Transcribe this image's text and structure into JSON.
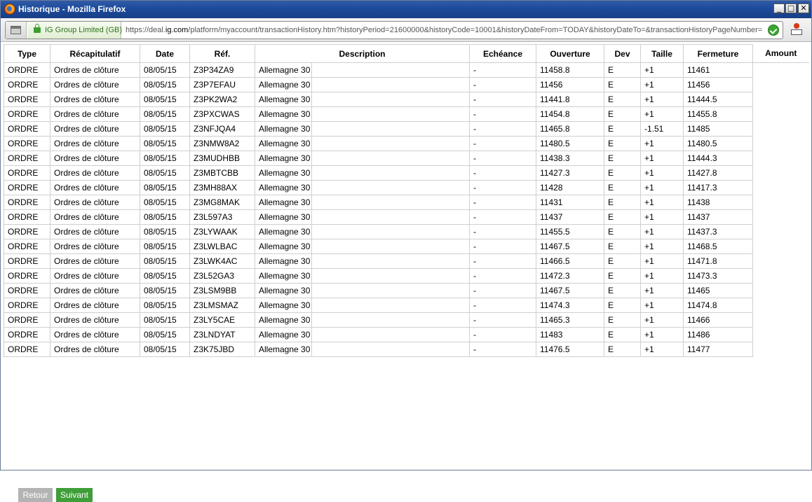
{
  "window": {
    "title": "Historique - Mozilla Firefox",
    "controls": {
      "minimize": "_",
      "maximize": "□",
      "close": "✕"
    }
  },
  "navbar": {
    "identity": "IG Group Limited (GB)",
    "url_prefix": "https://deal.",
    "url_domain": "ig.com",
    "url_rest": "/platform/myaccount/transactionHistory.htm?historyPeriod=21600000&historyCode=10001&historyDateFrom=TODAY&historyDateTo=&transactionHistoryPageNumber="
  },
  "table": {
    "headers": {
      "type": "Type",
      "summary": "Récapitulatif",
      "date": "Date",
      "ref": "Réf.",
      "description": "Description",
      "expiry": "Echéance",
      "open": "Ouverture",
      "currency": "Dev",
      "size": "Taille",
      "close": "Fermeture",
      "amount": "Amount"
    },
    "rows": [
      {
        "type": "ORDRE",
        "summary": "Ordres de clôture",
        "date": "08/05/15",
        "ref": "Z3P34ZA9",
        "description": "Allemagne 30",
        "expiry": "-",
        "open": "11458.8",
        "currency": "E",
        "size": "+1",
        "close": "11461"
      },
      {
        "type": "ORDRE",
        "summary": "Ordres de clôture",
        "date": "08/05/15",
        "ref": "Z3P7EFAU",
        "description": "Allemagne 30",
        "expiry": "-",
        "open": "11456",
        "currency": "E",
        "size": "+1",
        "close": "11456"
      },
      {
        "type": "ORDRE",
        "summary": "Ordres de clôture",
        "date": "08/05/15",
        "ref": "Z3PK2WA2",
        "description": "Allemagne 30",
        "expiry": "-",
        "open": "11441.8",
        "currency": "E",
        "size": "+1",
        "close": "11444.5"
      },
      {
        "type": "ORDRE",
        "summary": "Ordres de clôture",
        "date": "08/05/15",
        "ref": "Z3PXCWAS",
        "description": "Allemagne 30",
        "expiry": "-",
        "open": "11454.8",
        "currency": "E",
        "size": "+1",
        "close": "11455.8"
      },
      {
        "type": "ORDRE",
        "summary": "Ordres de clôture",
        "date": "08/05/15",
        "ref": "Z3NFJQA4",
        "description": "Allemagne 30",
        "expiry": "-",
        "open": "11465.8",
        "currency": "E",
        "size": "-1.51",
        "close": "11485"
      },
      {
        "type": "ORDRE",
        "summary": "Ordres de clôture",
        "date": "08/05/15",
        "ref": "Z3NMW8A2",
        "description": "Allemagne 30",
        "expiry": "-",
        "open": "11480.5",
        "currency": "E",
        "size": "+1",
        "close": "11480.5"
      },
      {
        "type": "ORDRE",
        "summary": "Ordres de clôture",
        "date": "08/05/15",
        "ref": "Z3MUDHBB",
        "description": "Allemagne 30",
        "expiry": "-",
        "open": "11438.3",
        "currency": "E",
        "size": "+1",
        "close": "11444.3"
      },
      {
        "type": "ORDRE",
        "summary": "Ordres de clôture",
        "date": "08/05/15",
        "ref": "Z3MBTCBB",
        "description": "Allemagne 30",
        "expiry": "-",
        "open": "11427.3",
        "currency": "E",
        "size": "+1",
        "close": "11427.8"
      },
      {
        "type": "ORDRE",
        "summary": "Ordres de clôture",
        "date": "08/05/15",
        "ref": "Z3MH88AX",
        "description": "Allemagne 30",
        "expiry": "-",
        "open": "11428",
        "currency": "E",
        "size": "+1",
        "close": "11417.3"
      },
      {
        "type": "ORDRE",
        "summary": "Ordres de clôture",
        "date": "08/05/15",
        "ref": "Z3MG8MAK",
        "description": "Allemagne 30",
        "expiry": "-",
        "open": "11431",
        "currency": "E",
        "size": "+1",
        "close": "11438"
      },
      {
        "type": "ORDRE",
        "summary": "Ordres de clôture",
        "date": "08/05/15",
        "ref": "Z3L597A3",
        "description": "Allemagne 30",
        "expiry": "-",
        "open": "11437",
        "currency": "E",
        "size": "+1",
        "close": "11437"
      },
      {
        "type": "ORDRE",
        "summary": "Ordres de clôture",
        "date": "08/05/15",
        "ref": "Z3LYWAAK",
        "description": "Allemagne 30",
        "expiry": "-",
        "open": "11455.5",
        "currency": "E",
        "size": "+1",
        "close": "11437.3"
      },
      {
        "type": "ORDRE",
        "summary": "Ordres de clôture",
        "date": "08/05/15",
        "ref": "Z3LWLBAC",
        "description": "Allemagne 30",
        "expiry": "-",
        "open": "11467.5",
        "currency": "E",
        "size": "+1",
        "close": "11468.5"
      },
      {
        "type": "ORDRE",
        "summary": "Ordres de clôture",
        "date": "08/05/15",
        "ref": "Z3LWK4AC",
        "description": "Allemagne 30",
        "expiry": "-",
        "open": "11466.5",
        "currency": "E",
        "size": "+1",
        "close": "11471.8"
      },
      {
        "type": "ORDRE",
        "summary": "Ordres de clôture",
        "date": "08/05/15",
        "ref": "Z3L52GA3",
        "description": "Allemagne 30",
        "expiry": "-",
        "open": "11472.3",
        "currency": "E",
        "size": "+1",
        "close": "11473.3"
      },
      {
        "type": "ORDRE",
        "summary": "Ordres de clôture",
        "date": "08/05/15",
        "ref": "Z3LSM9BB",
        "description": "Allemagne 30",
        "expiry": "-",
        "open": "11467.5",
        "currency": "E",
        "size": "+1",
        "close": "11465"
      },
      {
        "type": "ORDRE",
        "summary": "Ordres de clôture",
        "date": "08/05/15",
        "ref": "Z3LMSMAZ",
        "description": "Allemagne 30",
        "expiry": "-",
        "open": "11474.3",
        "currency": "E",
        "size": "+1",
        "close": "11474.8"
      },
      {
        "type": "ORDRE",
        "summary": "Ordres de clôture",
        "date": "08/05/15",
        "ref": "Z3LY5CAE",
        "description": "Allemagne 30",
        "expiry": "-",
        "open": "11465.3",
        "currency": "E",
        "size": "+1",
        "close": "11466"
      },
      {
        "type": "ORDRE",
        "summary": "Ordres de clôture",
        "date": "08/05/15",
        "ref": "Z3LNDYAT",
        "description": "Allemagne 30",
        "expiry": "-",
        "open": "11483",
        "currency": "E",
        "size": "+1",
        "close": "11486"
      },
      {
        "type": "ORDRE",
        "summary": "Ordres de clôture",
        "date": "08/05/15",
        "ref": "Z3K75JBD",
        "description": "Allemagne 30",
        "expiry": "-",
        "open": "11476.5",
        "currency": "E",
        "size": "+1",
        "close": "11477"
      }
    ]
  },
  "pagination": {
    "prev_label": "Retour",
    "next_label": "Suivant"
  },
  "colors": {
    "titlebar": "#1d4a9a",
    "next_button": "#3f9e38",
    "prev_button": "#b3b3b3",
    "secure": "#3f9d2f"
  }
}
